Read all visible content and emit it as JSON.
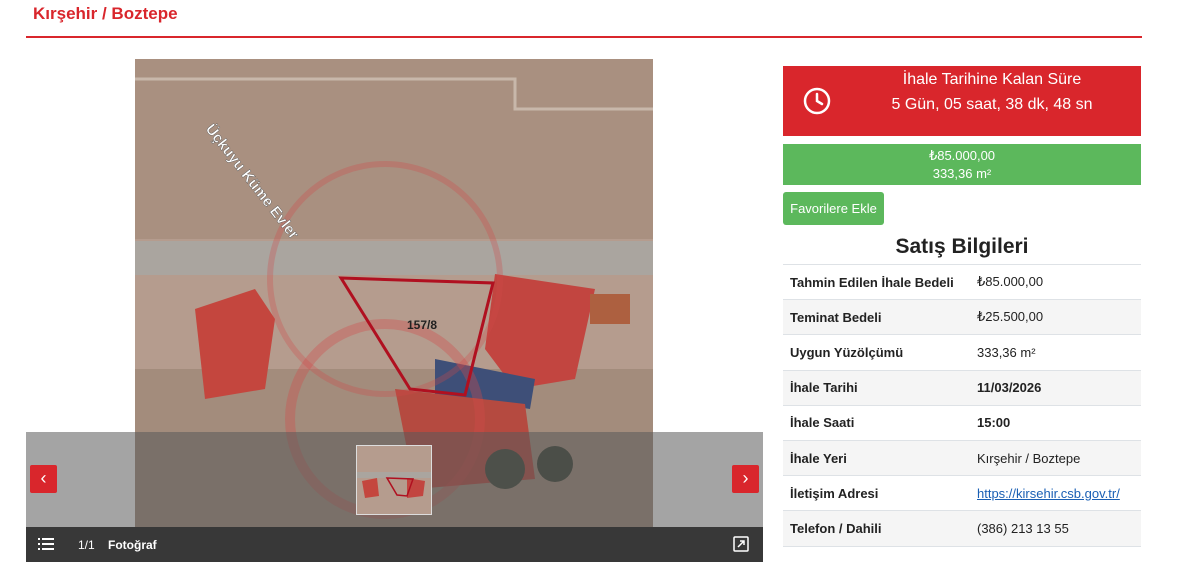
{
  "header": {
    "title": "Kırşehir / Boztepe"
  },
  "gallery": {
    "photo_label": "157/8",
    "road_label": "Üçkuyu Küme Evler",
    "counter": "1/1",
    "caption": "Fotoğraf",
    "prev_icon": "chevron-left-icon",
    "next_icon": "chevron-right-icon"
  },
  "countdown": {
    "label": "İhale Tarihine Kalan Süre",
    "value": "5 Gün, 05 saat, 38 dk, 48 sn",
    "icon": "clock-icon"
  },
  "price": {
    "amount": "₺85.000,00",
    "area": "333,36 m²"
  },
  "favorite_button": {
    "label": "Favorilere Ekle"
  },
  "sales_info": {
    "title": "Satış Bilgileri",
    "rows": [
      {
        "label": "Tahmin Edilen İhale Bedeli",
        "value": "₺85.000,00"
      },
      {
        "label": "Teminat Bedeli",
        "value": "₺25.500,00"
      },
      {
        "label": "Uygun Yüzölçümü",
        "value": "333,36 m²"
      },
      {
        "label": "İhale Tarihi",
        "value": "11/03/2026"
      },
      {
        "label": "İhale Saati",
        "value": "15:00"
      },
      {
        "label": "İhale Yeri",
        "value": "Kırşehir / Boztepe"
      },
      {
        "label": "İletişim Adresi",
        "value": "https://kirsehir.csb.gov.tr/"
      },
      {
        "label": "Telefon / Dahili",
        "value": "(386) 213 13 55"
      }
    ]
  },
  "colors": {
    "accent_red": "#d9262c",
    "success_green": "#5cb85c",
    "link_blue": "#1a5fb4"
  }
}
